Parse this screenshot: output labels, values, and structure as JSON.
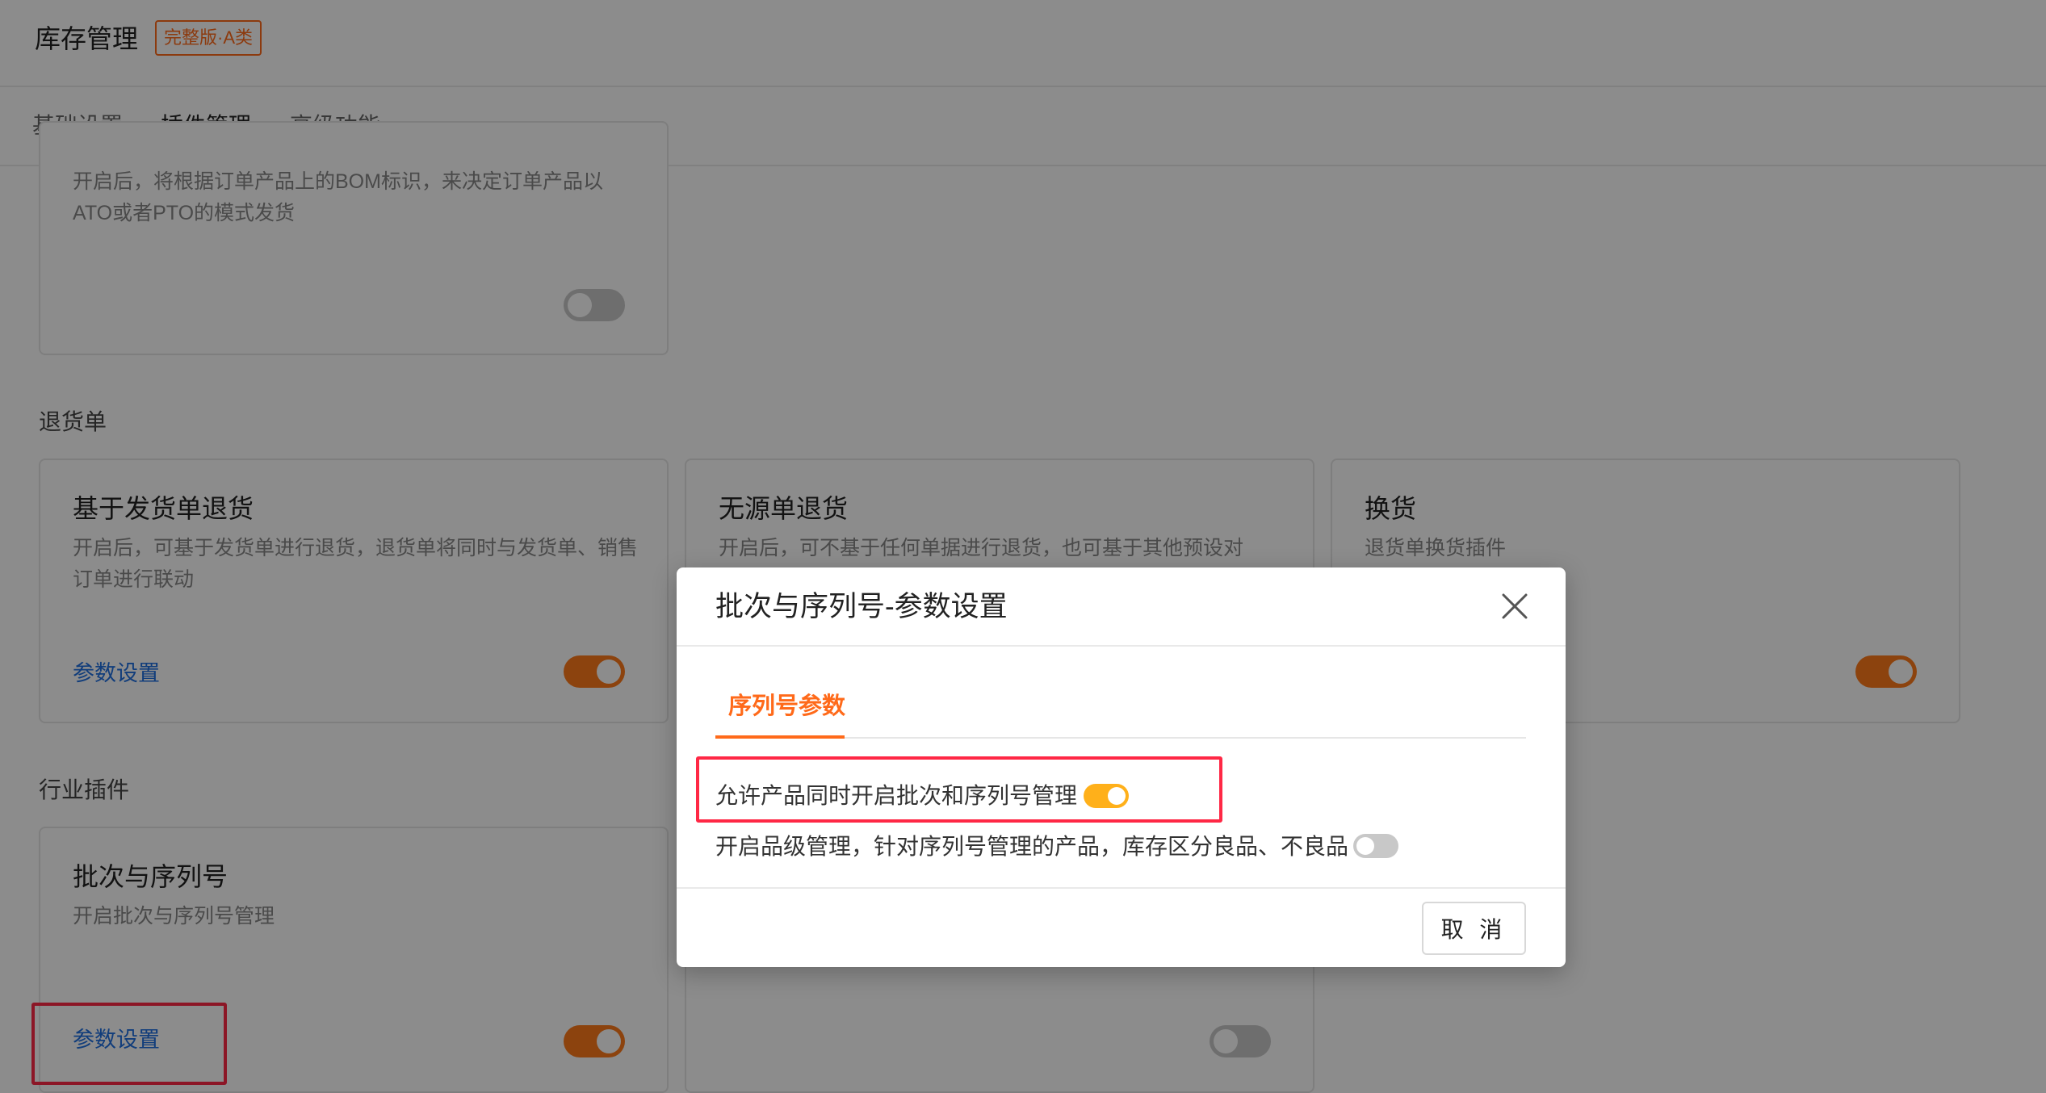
{
  "header": {
    "title": "库存管理",
    "badge": "完整版·A类"
  },
  "tabs": [
    {
      "label": "基础设置",
      "active": false
    },
    {
      "label": "插件管理",
      "active": true
    },
    {
      "label": "高级功能",
      "active": false
    }
  ],
  "top_card": {
    "desc": "开启后，将根据订单产品上的BOM标识，来决定订单产品以ATO或者PTO的模式发货",
    "switch_on": false
  },
  "returns_section": {
    "title": "退货单",
    "cards": [
      {
        "title": "基于发货单退货",
        "desc": "开启后，可基于发货单进行退货，退货单将同时与发货单、销售订单进行联动",
        "link": "参数设置",
        "switch_on": true
      },
      {
        "title": "无源单退货",
        "desc": "开启后，可不基于任何单据进行退货，也可基于其他预设对",
        "link": "",
        "switch_on": false
      },
      {
        "title": "换货",
        "desc": "退货单换货插件",
        "link": "",
        "switch_on": true
      }
    ]
  },
  "industry_section": {
    "title": "行业插件",
    "cards": [
      {
        "title": "批次与序列号",
        "desc": "开启批次与序列号管理",
        "link": "参数设置",
        "switch_on": true
      },
      {
        "title": "",
        "desc": "",
        "link": "",
        "switch_on": false
      }
    ]
  },
  "modal": {
    "title": "批次与序列号-参数设置",
    "tab": "序列号参数",
    "options": [
      {
        "label": "允许产品同时开启批次和序列号管理",
        "switch_on": true
      },
      {
        "label": "开启品级管理，针对序列号管理的产品，库存区分良品、不良品",
        "switch_on": false
      }
    ],
    "cancel_label": "取 消"
  },
  "colors": {
    "accent": "#ff6a1a",
    "link": "#1f6fe0",
    "highlight": "#ff2845"
  }
}
